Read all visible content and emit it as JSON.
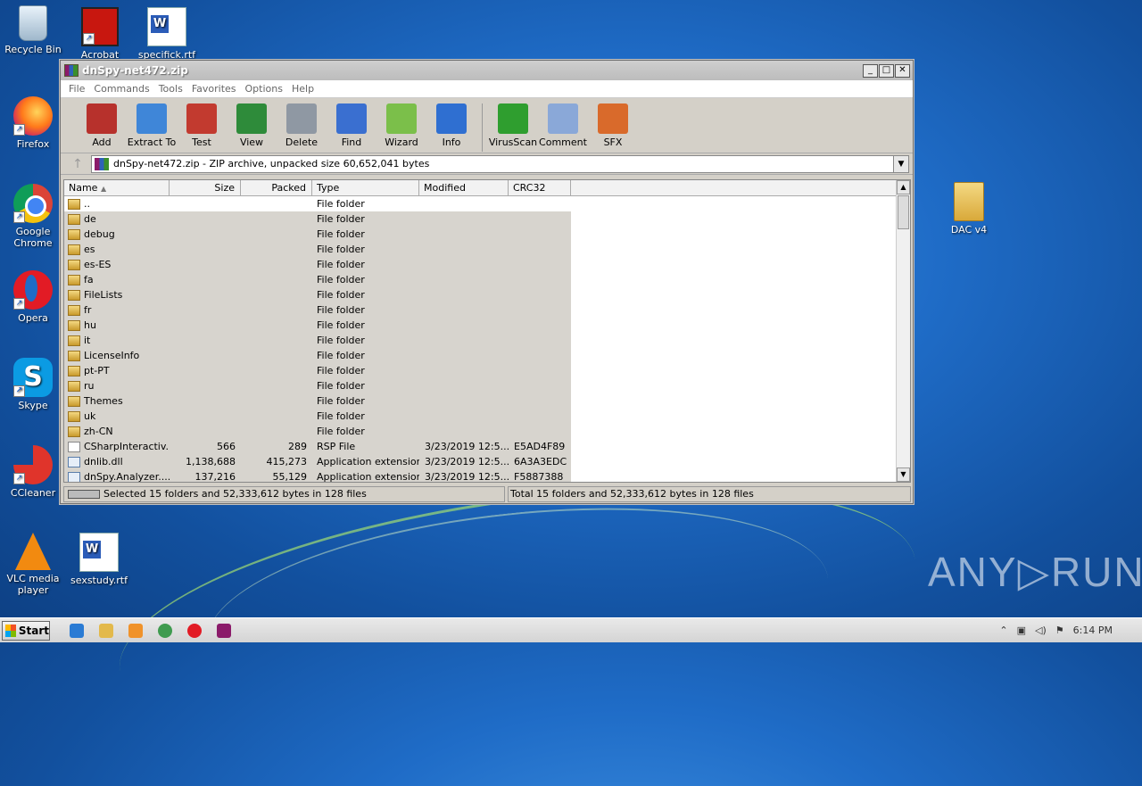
{
  "desktop": {
    "icons_left": [
      {
        "label": "Recycle Bin",
        "icon": "recycle-bin-icon"
      },
      {
        "label": "Acrobat",
        "icon": "acrobat-icon"
      },
      {
        "label": "specifick.rtf",
        "icon": "word-document-icon"
      },
      {
        "label": "Firefox",
        "icon": "firefox-icon"
      },
      {
        "label": "Google Chrome",
        "icon": "chrome-icon"
      },
      {
        "label": "Opera",
        "icon": "opera-icon"
      },
      {
        "label": "Skype",
        "icon": "skype-icon"
      },
      {
        "label": "CCleaner",
        "icon": "ccleaner-icon"
      },
      {
        "label": "VLC media player",
        "icon": "vlc-icon"
      },
      {
        "label": "sexstudy.rtf",
        "icon": "word-document-icon"
      }
    ],
    "icon_right": {
      "label": "DAC v4",
      "icon": "folder-icon"
    },
    "watermark": "ANY▷RUN"
  },
  "window": {
    "title": "dnSpy-net472.zip",
    "menu": [
      "File",
      "Commands",
      "Tools",
      "Favorites",
      "Options",
      "Help"
    ],
    "toolbar": [
      {
        "label": "Add",
        "icon": "add-archive-icon",
        "color": "#b7312c"
      },
      {
        "label": "Extract To",
        "icon": "extract-folder-icon",
        "color": "#3f86d8"
      },
      {
        "label": "Test",
        "icon": "test-clipboard-icon",
        "color": "#c23a2f"
      },
      {
        "label": "View",
        "icon": "view-book-icon",
        "color": "#2e8b3a"
      },
      {
        "label": "Delete",
        "icon": "delete-trash-icon",
        "color": "#8f98a3"
      },
      {
        "label": "Find",
        "icon": "find-magnifier-icon",
        "color": "#3a6fd0"
      },
      {
        "label": "Wizard",
        "icon": "wizard-wand-icon",
        "color": "#7bbf4a"
      },
      {
        "label": "Info",
        "icon": "info-icon",
        "color": "#2f6fd1"
      },
      {
        "label": "VirusScan",
        "icon": "virus-scan-icon",
        "color": "#2f9e2f"
      },
      {
        "label": "Comment",
        "icon": "comment-icon",
        "color": "#8aa8d8"
      },
      {
        "label": "SFX",
        "icon": "sfx-icon",
        "color": "#d96a2b"
      }
    ],
    "address": "dnSpy-net472.zip - ZIP archive, unpacked size 60,652,041 bytes",
    "columns": [
      "Name",
      "Size",
      "Packed",
      "Type",
      "Modified",
      "CRC32"
    ],
    "rows": [
      {
        "name": "..",
        "size": "",
        "packed": "",
        "type": "File folder",
        "modified": "",
        "crc": "",
        "kind": "folder"
      },
      {
        "name": "de",
        "size": "",
        "packed": "",
        "type": "File folder",
        "modified": "",
        "crc": "",
        "kind": "folder"
      },
      {
        "name": "debug",
        "size": "",
        "packed": "",
        "type": "File folder",
        "modified": "",
        "crc": "",
        "kind": "folder"
      },
      {
        "name": "es",
        "size": "",
        "packed": "",
        "type": "File folder",
        "modified": "",
        "crc": "",
        "kind": "folder"
      },
      {
        "name": "es-ES",
        "size": "",
        "packed": "",
        "type": "File folder",
        "modified": "",
        "crc": "",
        "kind": "folder"
      },
      {
        "name": "fa",
        "size": "",
        "packed": "",
        "type": "File folder",
        "modified": "",
        "crc": "",
        "kind": "folder"
      },
      {
        "name": "FileLists",
        "size": "",
        "packed": "",
        "type": "File folder",
        "modified": "",
        "crc": "",
        "kind": "folder"
      },
      {
        "name": "fr",
        "size": "",
        "packed": "",
        "type": "File folder",
        "modified": "",
        "crc": "",
        "kind": "folder"
      },
      {
        "name": "hu",
        "size": "",
        "packed": "",
        "type": "File folder",
        "modified": "",
        "crc": "",
        "kind": "folder"
      },
      {
        "name": "it",
        "size": "",
        "packed": "",
        "type": "File folder",
        "modified": "",
        "crc": "",
        "kind": "folder"
      },
      {
        "name": "LicenseInfo",
        "size": "",
        "packed": "",
        "type": "File folder",
        "modified": "",
        "crc": "",
        "kind": "folder"
      },
      {
        "name": "pt-PT",
        "size": "",
        "packed": "",
        "type": "File folder",
        "modified": "",
        "crc": "",
        "kind": "folder"
      },
      {
        "name": "ru",
        "size": "",
        "packed": "",
        "type": "File folder",
        "modified": "",
        "crc": "",
        "kind": "folder"
      },
      {
        "name": "Themes",
        "size": "",
        "packed": "",
        "type": "File folder",
        "modified": "",
        "crc": "",
        "kind": "folder"
      },
      {
        "name": "uk",
        "size": "",
        "packed": "",
        "type": "File folder",
        "modified": "",
        "crc": "",
        "kind": "folder"
      },
      {
        "name": "zh-CN",
        "size": "",
        "packed": "",
        "type": "File folder",
        "modified": "",
        "crc": "",
        "kind": "folder"
      },
      {
        "name": "CSharpInteractiv...",
        "size": "566",
        "packed": "289",
        "type": "RSP File",
        "modified": "3/23/2019 12:5...",
        "crc": "E5AD4F89",
        "kind": "file"
      },
      {
        "name": "dnlib.dll",
        "size": "1,138,688",
        "packed": "415,273",
        "type": "Application extension",
        "modified": "3/23/2019 12:5...",
        "crc": "6A3A3EDC",
        "kind": "dll"
      },
      {
        "name": "dnSpy.Analyzer....",
        "size": "137,216",
        "packed": "55,129",
        "type": "Application extension",
        "modified": "3/23/2019 12:5...",
        "crc": "F5887388",
        "kind": "dll"
      }
    ],
    "status_left": "Selected 15 folders and 52,333,612 bytes in 128 files",
    "status_right": "Total 15 folders and 52,333,612 bytes in 128 files"
  },
  "taskbar": {
    "start_label": "Start",
    "apps": [
      {
        "icon": "internet-explorer-icon",
        "color": "#2a7bd4"
      },
      {
        "icon": "explorer-folder-icon",
        "color": "#e3b94b"
      },
      {
        "icon": "media-player-icon",
        "color": "#f0922a"
      },
      {
        "icon": "chrome-icon",
        "color": "#3f9b4f"
      },
      {
        "icon": "opera-icon",
        "color": "#e21b25"
      },
      {
        "icon": "winrar-icon",
        "color": "#8b1b6a"
      }
    ],
    "clock": "6:14 PM"
  }
}
